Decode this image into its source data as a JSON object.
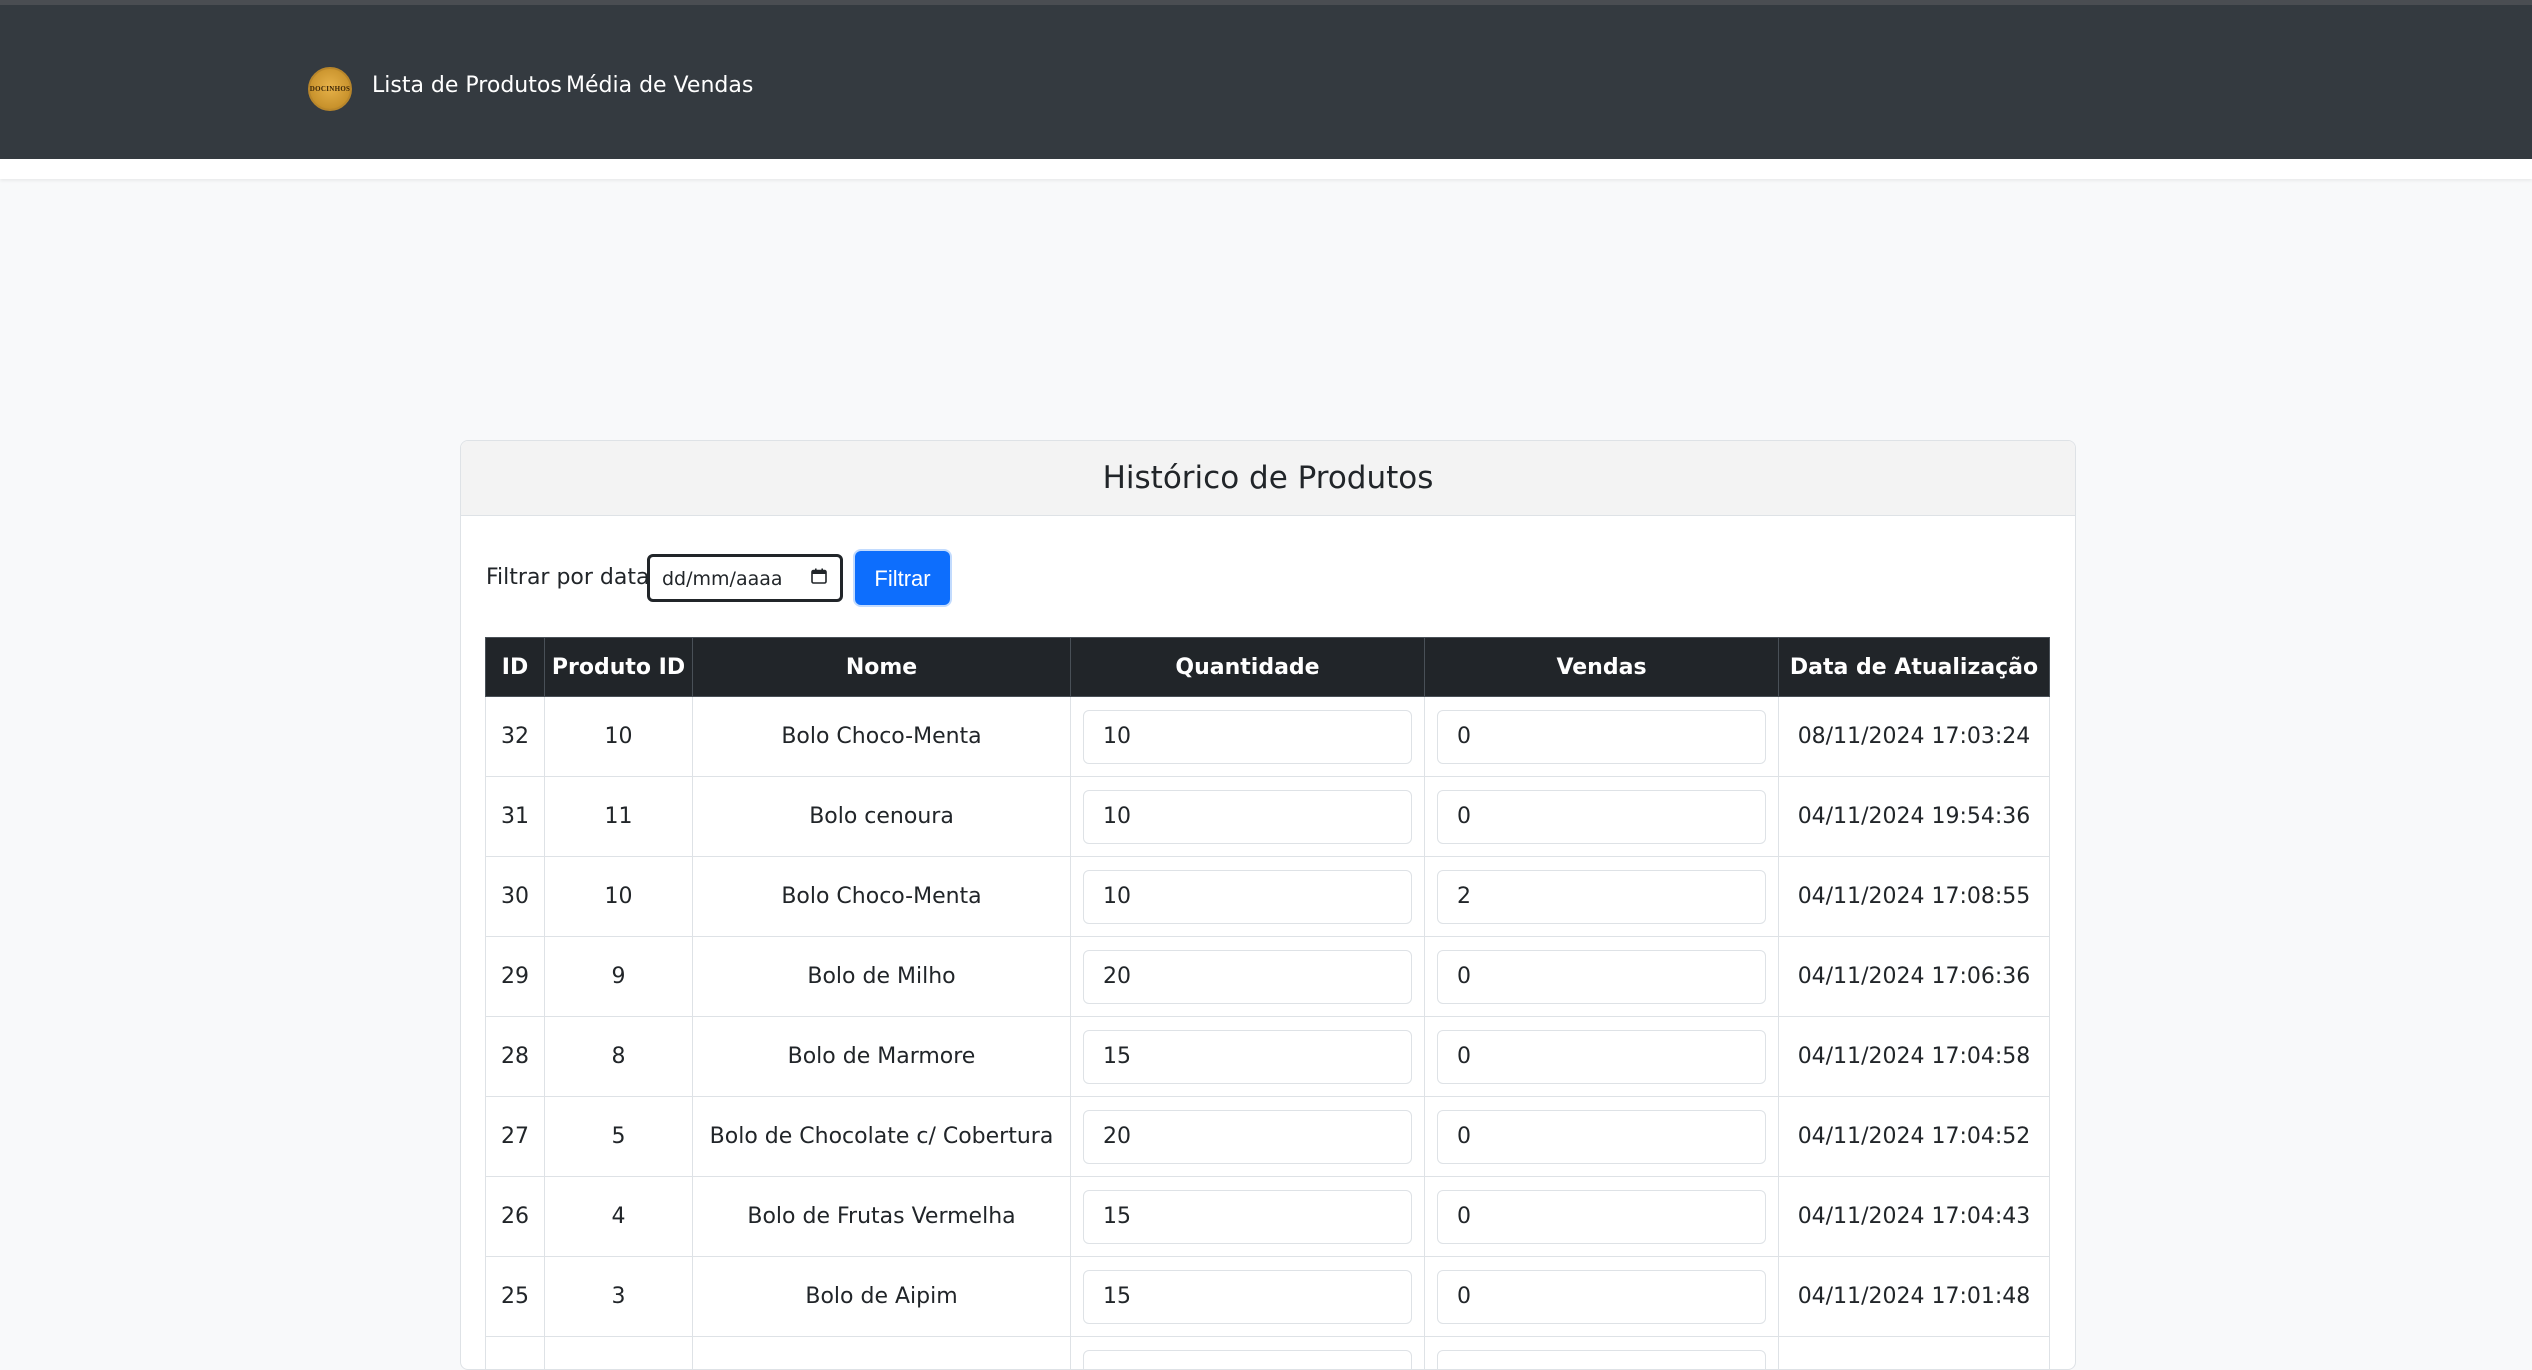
{
  "nav": {
    "brand_text": "DOCINHOS",
    "links": [
      "Lista de Produtos",
      "Média de Vendas"
    ]
  },
  "card": {
    "title": "Histórico de Produtos",
    "filter_label": "Filtrar por data:",
    "date_placeholder": "dd/mm/aaaa",
    "filter_button": "Filtrar"
  },
  "table": {
    "headers": [
      "ID",
      "Produto ID",
      "Nome",
      "Quantidade",
      "Vendas",
      "Data de Atualização"
    ],
    "rows": [
      {
        "id": "32",
        "produto_id": "10",
        "nome": "Bolo Choco-Menta",
        "quantidade": "10",
        "vendas": "0",
        "data": "08/11/2024 17:03:24"
      },
      {
        "id": "31",
        "produto_id": "11",
        "nome": "Bolo cenoura",
        "quantidade": "10",
        "vendas": "0",
        "data": "04/11/2024 19:54:36"
      },
      {
        "id": "30",
        "produto_id": "10",
        "nome": "Bolo Choco-Menta",
        "quantidade": "10",
        "vendas": "2",
        "data": "04/11/2024 17:08:55"
      },
      {
        "id": "29",
        "produto_id": "9",
        "nome": "Bolo de Milho",
        "quantidade": "20",
        "vendas": "0",
        "data": "04/11/2024 17:06:36"
      },
      {
        "id": "28",
        "produto_id": "8",
        "nome": "Bolo de Marmore",
        "quantidade": "15",
        "vendas": "0",
        "data": "04/11/2024 17:04:58"
      },
      {
        "id": "27",
        "produto_id": "5",
        "nome": "Bolo de Chocolate c/ Cobertura",
        "quantidade": "20",
        "vendas": "0",
        "data": "04/11/2024 17:04:52"
      },
      {
        "id": "26",
        "produto_id": "4",
        "nome": "Bolo de Frutas Vermelha",
        "quantidade": "15",
        "vendas": "0",
        "data": "04/11/2024 17:04:43"
      },
      {
        "id": "25",
        "produto_id": "3",
        "nome": "Bolo de Aipim",
        "quantidade": "15",
        "vendas": "0",
        "data": "04/11/2024 17:01:48"
      }
    ]
  }
}
